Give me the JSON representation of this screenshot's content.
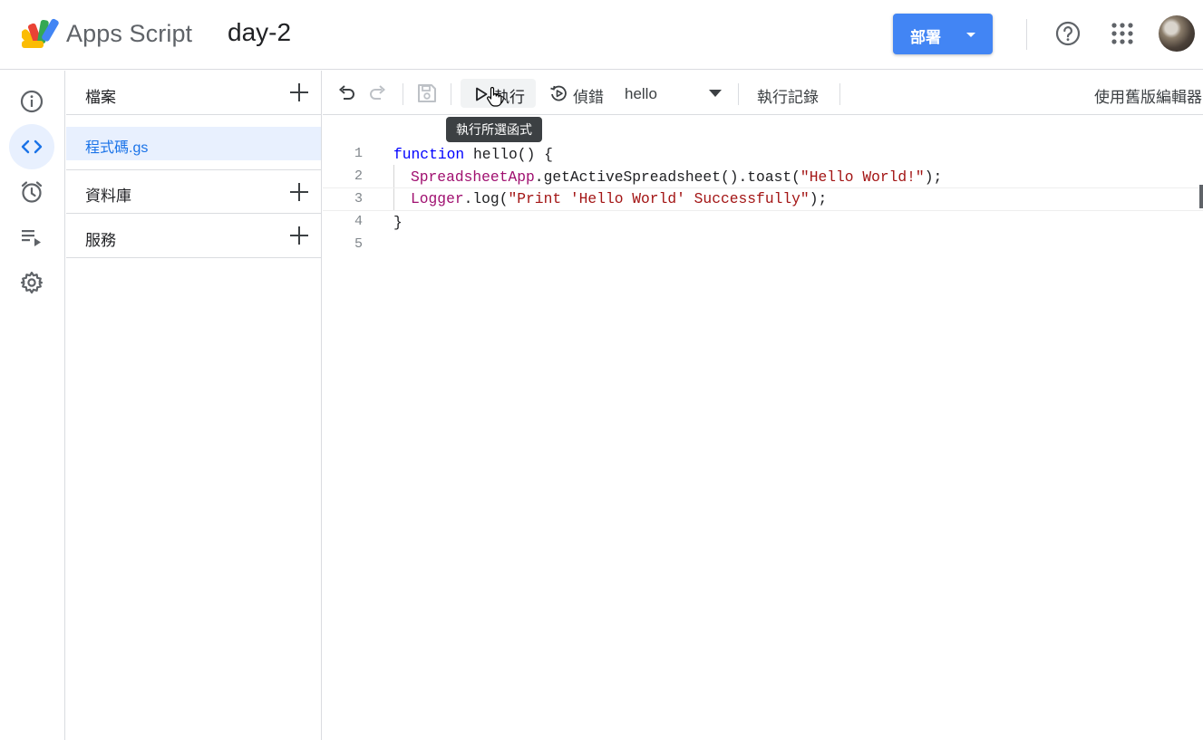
{
  "header": {
    "app_name": "Apps Script",
    "project_title": "day-2",
    "deploy_label": "部署",
    "brand_color": "#4285f4"
  },
  "rail": {
    "items": [
      {
        "icon": "info-icon",
        "active": false
      },
      {
        "icon": "code-icon",
        "active": true
      },
      {
        "icon": "alarm-clock-icon",
        "active": false
      },
      {
        "icon": "executions-list-icon",
        "active": false
      },
      {
        "icon": "settings-gear-icon",
        "active": false
      }
    ]
  },
  "files": {
    "section_files": "檔案",
    "file_name": "程式碼.gs",
    "section_libraries": "資料庫",
    "section_services": "服務"
  },
  "toolbar": {
    "run_label": "執行",
    "debug_label": "偵錯",
    "function_selected": "hello",
    "execution_log_label": "執行記錄",
    "legacy_editor_label": "使用舊版編輯器"
  },
  "tooltip": {
    "text": "執行所選函式"
  },
  "editor": {
    "lines": [
      {
        "num": "1"
      },
      {
        "num": "2"
      },
      {
        "num": "3"
      },
      {
        "num": "4"
      },
      {
        "num": "5"
      }
    ],
    "tokens": {
      "l1_kw": "function",
      "l1_rest": " hello() {",
      "l2_cls": "SpreadsheetApp",
      "l2_mid": ".getActiveSpreadsheet().toast(",
      "l2_str": "\"Hello World!\"",
      "l2_end": ");",
      "l3_cls": "Logger",
      "l3_mid": ".log(",
      "l3_str": "\"Print 'Hello World' Successfully\"",
      "l3_end": ");",
      "l4": "}"
    }
  }
}
